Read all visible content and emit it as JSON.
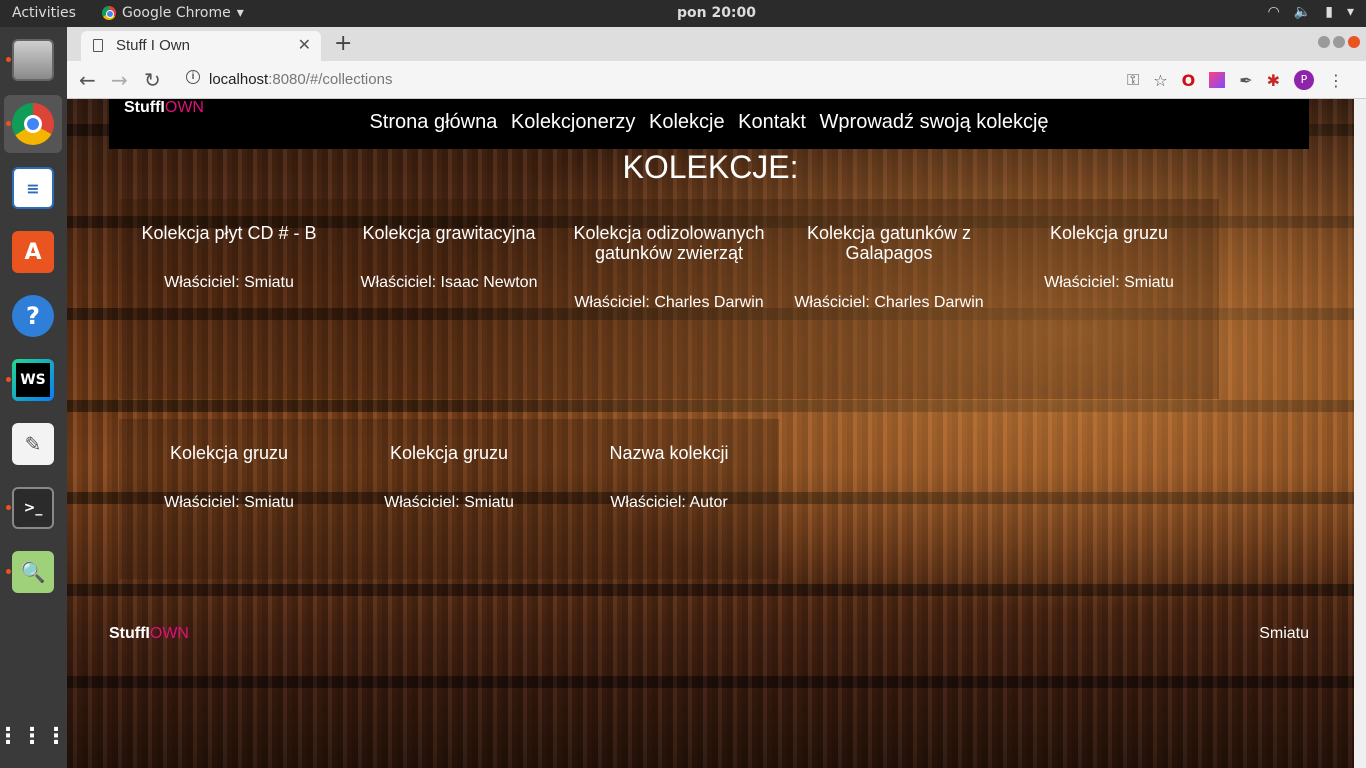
{
  "system": {
    "activities": "Activities",
    "app_name": "Google Chrome",
    "clock": "pon 20:00"
  },
  "dock": {
    "items": [
      "files-icon",
      "chrome-icon",
      "writer-icon",
      "software-center-icon",
      "help-icon",
      "webstorm-icon",
      "text-editor-icon",
      "terminal-icon",
      "image-viewer-icon",
      "app-grid-icon"
    ]
  },
  "browser": {
    "tab_title": "Stuff I Own",
    "url_host": "localhost",
    "url_rest": ":8080/#/collections",
    "profile_initial": "P"
  },
  "site": {
    "brand_white": "StuffI",
    "brand_pink": "OWN",
    "brand_color": "#e0107a",
    "nav": [
      "Strona główna",
      "Kolekcjonerzy",
      "Kolekcje",
      "Kontakt",
      "Wprowadź swoją kolekcję"
    ],
    "heading": "KOLEKCJE:",
    "collections": [
      {
        "name": "Kolekcja płyt CD # - B",
        "owner": "Właściciel: Smiatu"
      },
      {
        "name": "Kolekcja grawitacyjna",
        "owner": "Właściciel: Isaac Newton"
      },
      {
        "name": "Kolekcja odizolowanych gatunków zwierząt",
        "owner": "Właściciel: Charles Darwin"
      },
      {
        "name": "Kolekcja gatunków z Galapagos",
        "owner": "Właściciel: Charles Darwin"
      },
      {
        "name": "Kolekcja gruzu",
        "owner": "Właściciel: Smiatu"
      },
      {
        "name": "Kolekcja gruzu",
        "owner": "Właściciel: Smiatu"
      },
      {
        "name": "Kolekcja gruzu",
        "owner": "Właściciel: Smiatu"
      },
      {
        "name": "Nazwa kolekcji",
        "owner": "Właściciel: Autor"
      }
    ],
    "footer_author": "Smiatu"
  }
}
